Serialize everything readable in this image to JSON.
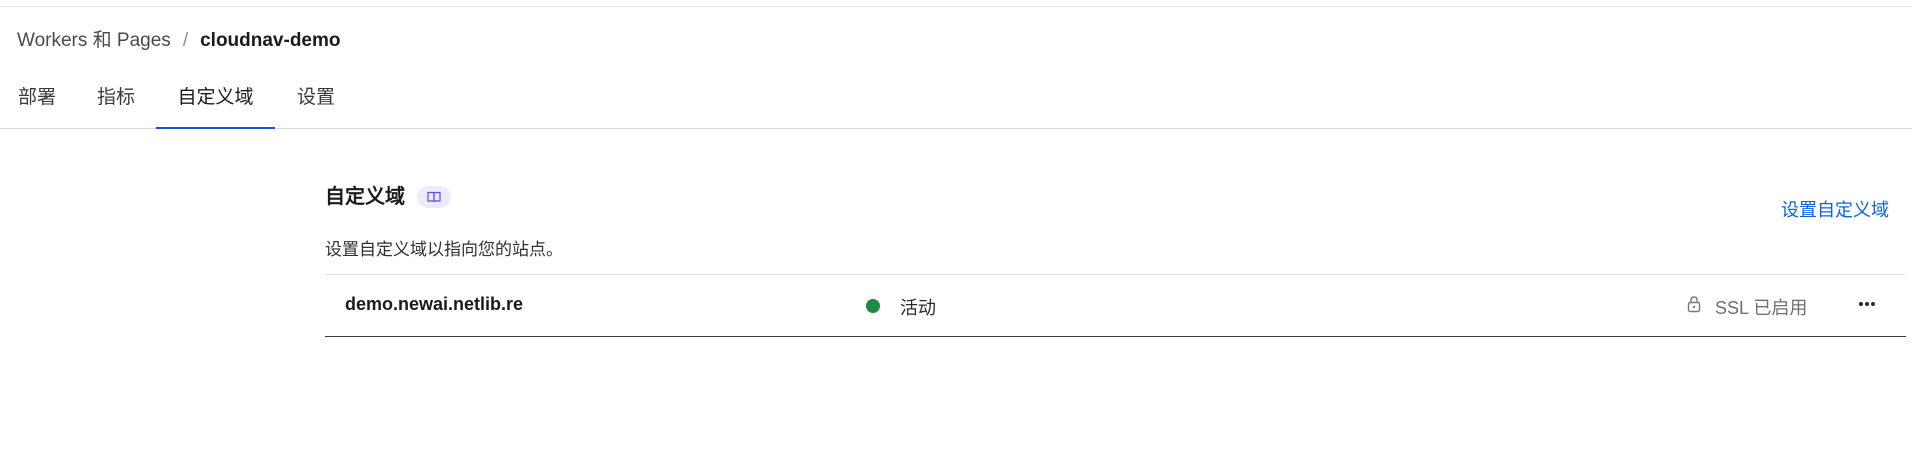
{
  "breadcrumb": {
    "parent": "Workers 和 Pages",
    "separator": "/",
    "current": "cloudnav-demo"
  },
  "tabs": [
    {
      "label": "部署",
      "active": false
    },
    {
      "label": "指标",
      "active": false
    },
    {
      "label": "自定义域",
      "active": true
    },
    {
      "label": "设置",
      "active": false
    }
  ],
  "section": {
    "title": "自定义域",
    "docs_icon": "book-icon",
    "description": "设置自定义域以指向您的站点。",
    "action_label": "设置自定义域"
  },
  "domains": [
    {
      "name": "demo.newai.netlib.re",
      "status": "活动",
      "status_color": "#1f8a43",
      "ssl_icon": "lock-icon",
      "ssl": "SSL 已启用",
      "menu_icon": "more-horizontal-icon"
    }
  ],
  "colors": {
    "accent": "#1d4fd8",
    "link": "#0b63e5",
    "badge_bg": "#ecebfd"
  }
}
